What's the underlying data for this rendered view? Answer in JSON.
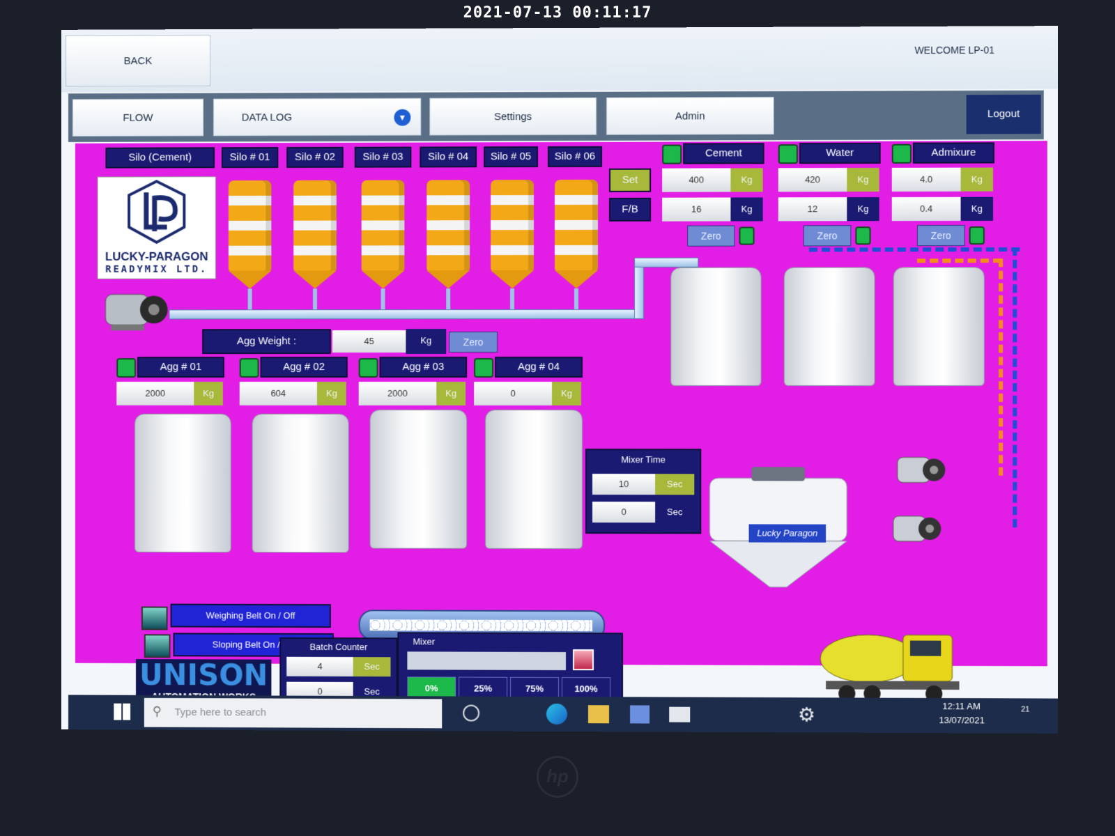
{
  "photo_timestamp": "2021-07-13 00:11:17",
  "header": {
    "back_label": "BACK",
    "welcome": "WELCOME LP-01"
  },
  "nav": {
    "flow": "FLOW",
    "datalog": "DATA LOG",
    "settings": "Settings",
    "admin": "Admin",
    "logout": "Logout"
  },
  "silos": {
    "header": "Silo (Cement)",
    "items": [
      "Silo # 01",
      "Silo # 02",
      "Silo # 03",
      "Silo # 04",
      "Silo # 05",
      "Silo # 06"
    ]
  },
  "logo": {
    "line1": "LUCKY-PARAGON",
    "line2": "READYMIX LTD."
  },
  "materials": {
    "set_label": "Set",
    "fb_label": "F/B",
    "zero_label": "Zero",
    "items": [
      {
        "name": "Cement",
        "set": "400",
        "fb": "16",
        "unit": "Kg"
      },
      {
        "name": "Water",
        "set": "420",
        "fb": "12",
        "unit": "Kg"
      },
      {
        "name": "Admixure",
        "set": "4.0",
        "fb": "0.4",
        "unit": "Kg"
      }
    ]
  },
  "agg_weight": {
    "label": "Agg Weight :",
    "value": "45",
    "unit": "Kg",
    "zero_label": "Zero"
  },
  "aggregates": [
    {
      "name": "Agg # 01",
      "value": "2000",
      "unit": "Kg"
    },
    {
      "name": "Agg # 02",
      "value": "604",
      "unit": "Kg"
    },
    {
      "name": "Agg # 03",
      "value": "2000",
      "unit": "Kg"
    },
    {
      "name": "Agg # 04",
      "value": "0",
      "unit": "Kg"
    }
  ],
  "mixer_time": {
    "label": "Mixer Time",
    "set": "10",
    "fb": "0",
    "unit": "Sec"
  },
  "mixer_brand": "Lucky Paragon",
  "belts": {
    "weighing": "Weighing Belt On / Off",
    "sloping": "Sloping Belt On / Off"
  },
  "batch_counter": {
    "label": "Batch Counter",
    "set": "4",
    "fb": "0",
    "unit": "Sec"
  },
  "mixer_panel": {
    "label": "Mixer",
    "percentages": [
      "0%",
      "25%",
      "75%",
      "100%"
    ],
    "level": 0
  },
  "brand": {
    "line1": "UNISON",
    "line2": "AUTOMATION WORKS"
  },
  "taskbar": {
    "search_placeholder": "Type here to search",
    "time": "12:11 AM",
    "date": "13/07/2021",
    "notif_count": "21"
  },
  "colors": {
    "background": "#e21ee6",
    "label": "#1a1a72",
    "unit": "#a8b83a",
    "led": "#1db84a",
    "silo": "#f2a817"
  }
}
